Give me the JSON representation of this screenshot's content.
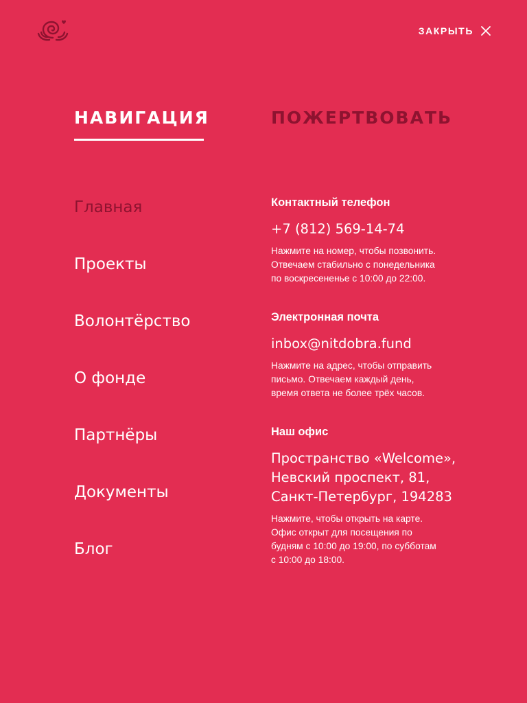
{
  "header": {
    "logo_icon": "snail-heart-logo",
    "close_label": "ЗАКРЫТЬ",
    "close_icon": "close-icon"
  },
  "tabs": [
    {
      "label": "НАВИГАЦИЯ",
      "active": true
    },
    {
      "label": "ПОЖЕРТВОВАТЬ",
      "active": false
    }
  ],
  "nav": {
    "items": [
      {
        "label": "Главная",
        "active": true
      },
      {
        "label": "Проекты",
        "active": false
      },
      {
        "label": "Волонтёрство",
        "active": false
      },
      {
        "label": "О фонде",
        "active": false
      },
      {
        "label": "Партнёры",
        "active": false
      },
      {
        "label": "Документы",
        "active": false
      },
      {
        "label": "Блог",
        "active": false
      }
    ]
  },
  "contacts": {
    "phone": {
      "heading": "Контактный телефон",
      "value": "+7 (812) 569-14-74",
      "note_lines": [
        "Нажмите на номер, чтобы позвонить.",
        "Отвечаем стабильно с понедельника",
        "по воскресененье с 10:00 до 22:00."
      ]
    },
    "email": {
      "heading": "Электронная почта",
      "value": "inbox@nitdobra.fund",
      "note_lines": [
        "Нажмите на адрес, чтобы отправить",
        "письмо. Отвечаем каждый день,",
        "время ответа не более трёх часов."
      ]
    },
    "office": {
      "heading": "Наш офис",
      "value_lines": [
        "Пространство «Welcome»,",
        "Невский проспект,  81,",
        "Санкт-Петербург, 194283"
      ],
      "note_lines": [
        "Нажмите, чтобы открыть на карте.",
        "Офис открыт для посещения по",
        "будням с 10:00 до 19:00, по субботам",
        "с 10:00 до 18:00."
      ]
    }
  },
  "colors": {
    "background": "#e32d52",
    "text": "#ffffff",
    "accent_dark": "#8e1330"
  }
}
